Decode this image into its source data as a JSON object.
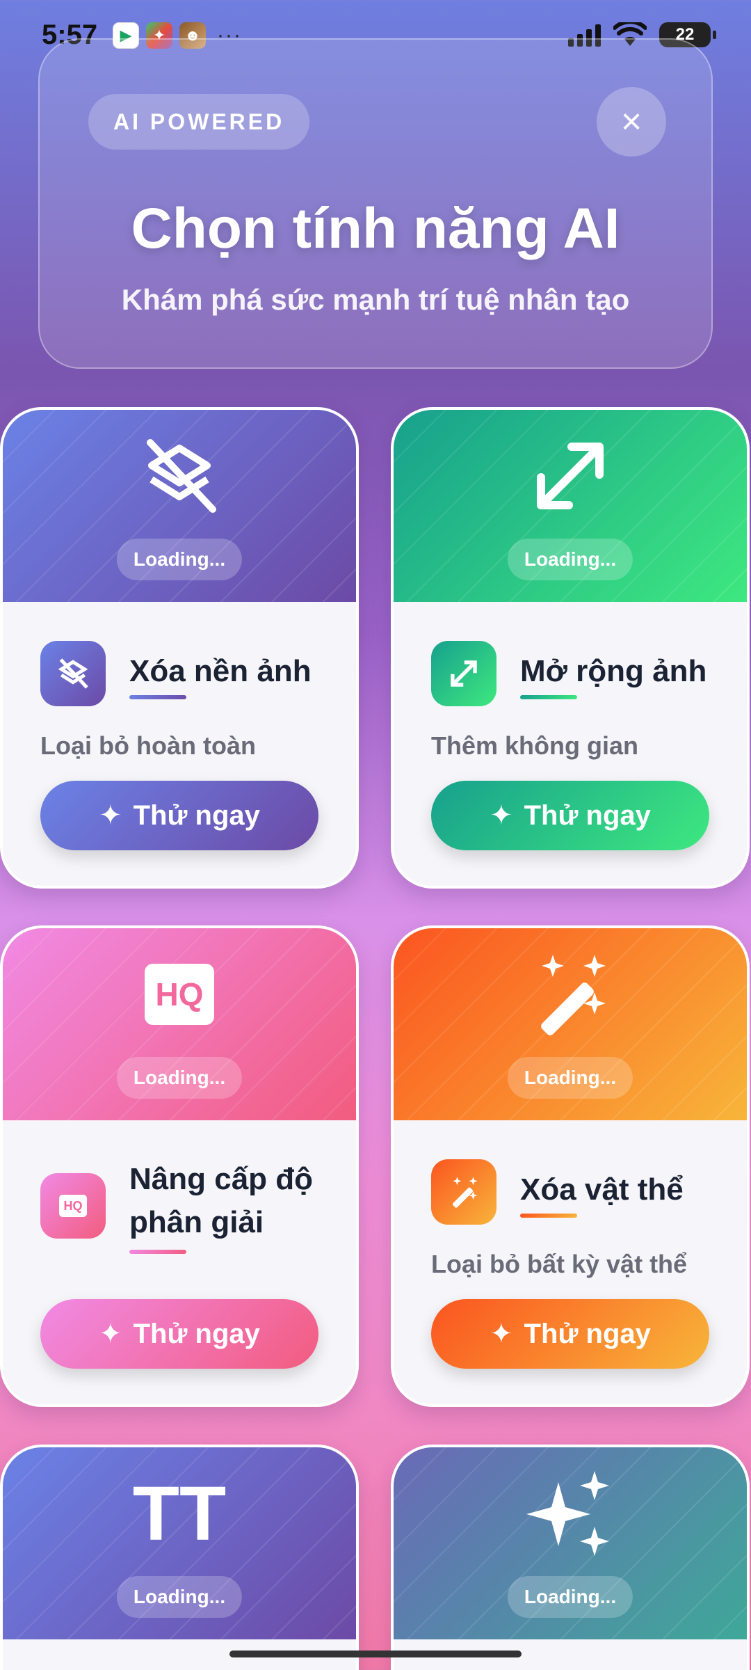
{
  "status_bar": {
    "time": "5:57",
    "more": "···",
    "battery": "22"
  },
  "header": {
    "badge": "AI POWERED",
    "close_icon": "×",
    "title": "Chọn tính năng AI",
    "subtitle": "Khám phá sức mạnh trí tuệ nhân tạo"
  },
  "features": [
    {
      "name": "Xóa nền ảnh",
      "desc": "Loại bỏ hoàn toàn",
      "button": "Thử ngay",
      "loading": "Loading...",
      "icon": "layers-off-icon"
    },
    {
      "name": "Mở rộng ảnh",
      "desc": "Thêm không gian",
      "button": "Thử ngay",
      "loading": "Loading...",
      "icon": "expand-icon"
    },
    {
      "name": "Nâng cấp độ phân giải",
      "desc": "",
      "button": "Thử ngay",
      "loading": "Loading...",
      "icon": "hq-icon",
      "icon_text": "HQ"
    },
    {
      "name": "Xóa vật thể",
      "desc": "Loại bỏ bất kỳ vật thể",
      "button": "Thử ngay",
      "loading": "Loading...",
      "icon": "magic-wand-icon"
    },
    {
      "name": "",
      "desc": "",
      "button": "",
      "loading": "Loading...",
      "icon": "text-size-icon",
      "icon_text": "TT"
    },
    {
      "name": "",
      "desc": "",
      "button": "",
      "loading": "Loading...",
      "icon": "sparkles-icon"
    }
  ],
  "colors": {
    "purple": [
      "#6b82e6",
      "#6c4aa6"
    ],
    "green": [
      "#17a08d",
      "#3ee87f"
    ],
    "pink": [
      "#f18ae4",
      "#f25c7f"
    ],
    "orange": [
      "#fb5520",
      "#f8b53a"
    ]
  }
}
